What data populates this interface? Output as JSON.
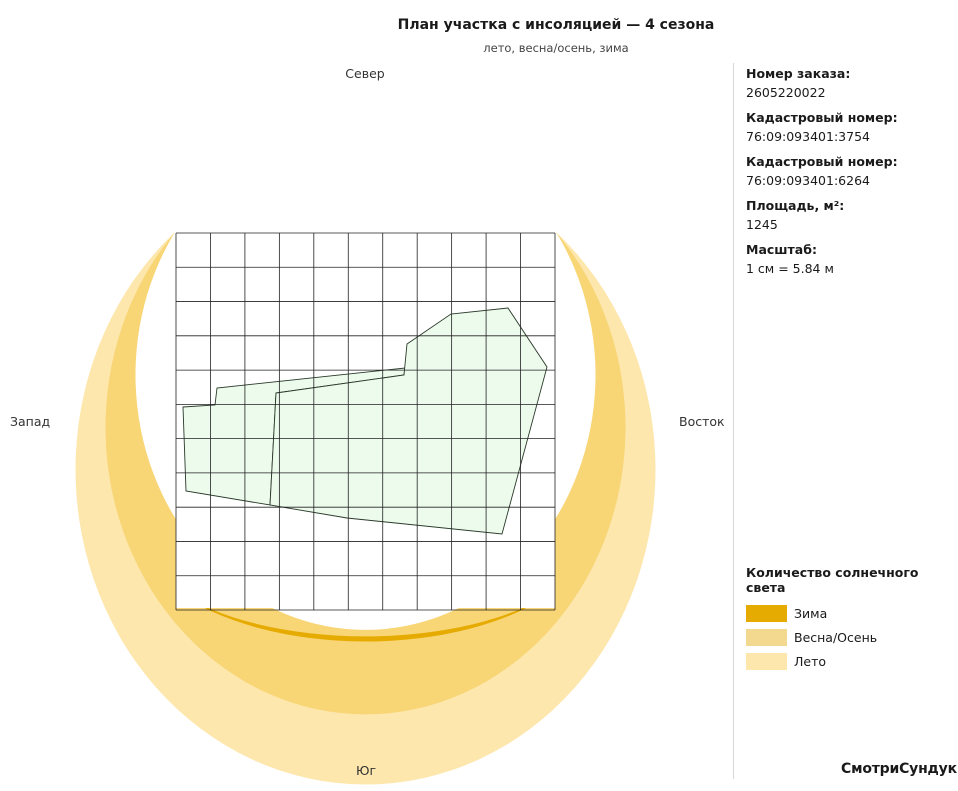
{
  "header": {
    "title": "План участка с инсоляцией — 4 сезона",
    "subtitle": "лето, весна/осень, зима"
  },
  "compass": {
    "north": "Север",
    "south": "Юг",
    "west": "Запад",
    "east": "Восток"
  },
  "info": [
    {
      "label": "Номер заказа:",
      "value": "2605220022"
    },
    {
      "label": "Кадастровый номер:",
      "value": "76:09:093401:3754"
    },
    {
      "label": "Кадастровый номер:",
      "value": "76:09:093401:6264"
    },
    {
      "label": "Площадь, м²:",
      "value": "1245"
    },
    {
      "label": "Масштаб:",
      "value": "1 см = 5.84 м"
    }
  ],
  "legend": {
    "title": "Количество солнечного света",
    "items": [
      {
        "label": "Зима",
        "color": "#e6ab00"
      },
      {
        "label": "Весна/Осень",
        "color": "#f2d98f"
      },
      {
        "label": "Лето",
        "color": "#fde7ad"
      }
    ]
  },
  "colors": {
    "summer": "#fde7ad",
    "spring_autumn": "#f8d575",
    "winter": "#e6ab00",
    "parcel_fill": "#ecfbec",
    "parcel_stroke": "#2a3a2a",
    "grid": "#222222"
  },
  "brand": "СмотриСундук."
}
